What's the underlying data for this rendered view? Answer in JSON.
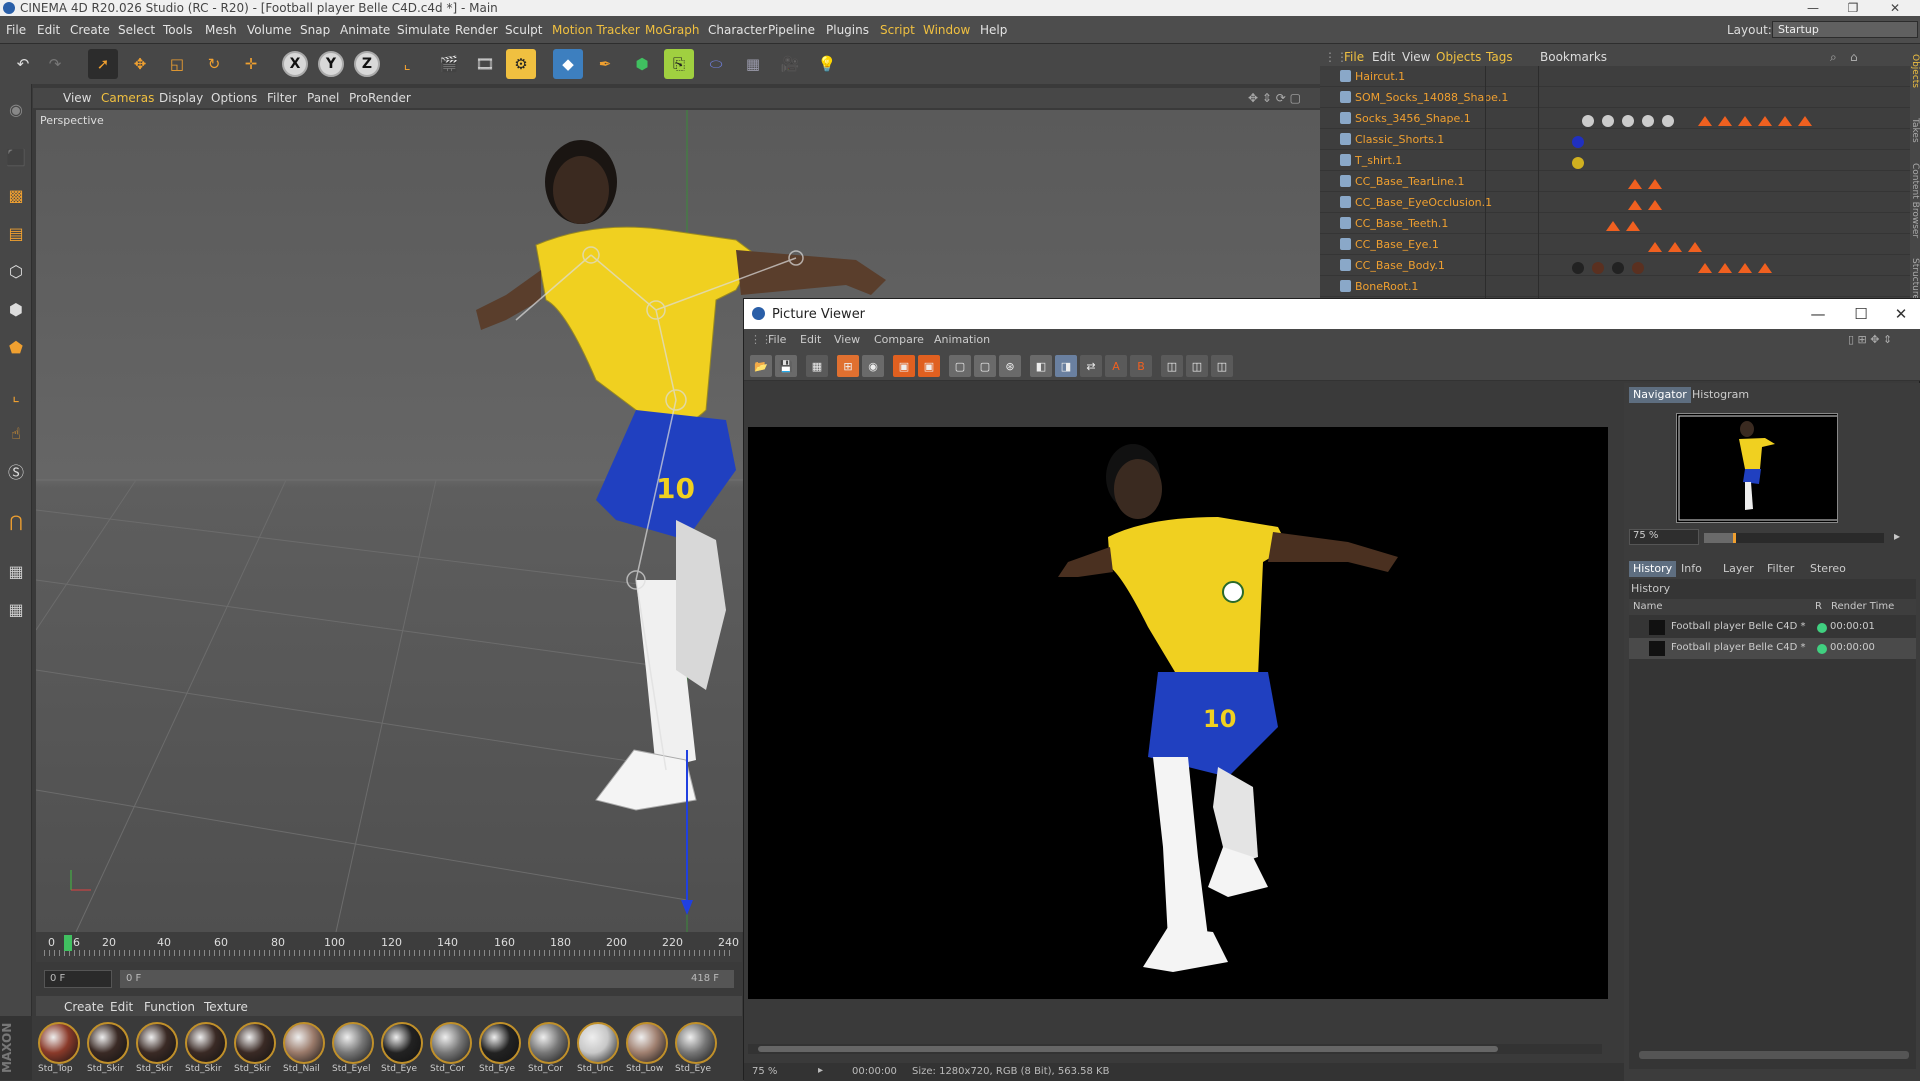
{
  "window": {
    "title": "CINEMA 4D R20.026 Studio (RC - R20) - [Football player Belle C4D.c4d *] - Main"
  },
  "menubar": {
    "items": [
      "File",
      "Edit",
      "Create",
      "Select",
      "Tools",
      "Mesh",
      "Volume",
      "Snap",
      "Animate",
      "Simulate",
      "Render",
      "Sculpt",
      "Motion Tracker",
      "MoGraph",
      "Character",
      "Pipeline",
      "Plugins",
      "Script",
      "Window",
      "Help"
    ],
    "layout_label": "Layout:",
    "layout_value": "Startup"
  },
  "viewport": {
    "menu": [
      "View",
      "Cameras",
      "Display",
      "Options",
      "Filter",
      "Panel",
      "ProRender"
    ],
    "label": "Perspective"
  },
  "timeline": {
    "ticks": [
      "0",
      "6",
      "20",
      "40",
      "60",
      "80",
      "100",
      "120",
      "140",
      "160",
      "180",
      "200",
      "220",
      "240"
    ],
    "frame_field": "0 F",
    "range_start": "0 F",
    "range_end": "418 F"
  },
  "materials": {
    "menu": [
      "Create",
      "Edit",
      "Function",
      "Texture"
    ],
    "items": [
      {
        "label": "Std_Top",
        "color": "#8a3a2a"
      },
      {
        "label": "Std_Skir",
        "color": "#3a2a25"
      },
      {
        "label": "Std_Skir",
        "color": "#3a2a25"
      },
      {
        "label": "Std_Skir",
        "color": "#3a2a25"
      },
      {
        "label": "Std_Skir",
        "color": "#3a2a25"
      },
      {
        "label": "Std_Nail",
        "color": "#9a7a6a"
      },
      {
        "label": "Std_Eyel",
        "color": "#777777"
      },
      {
        "label": "Std_Eye",
        "color": "#222222"
      },
      {
        "label": "Std_Cor",
        "color": "#777777"
      },
      {
        "label": "Std_Eye",
        "color": "#222222"
      },
      {
        "label": "Std_Cor",
        "color": "#777777"
      },
      {
        "label": "Std_Unc",
        "color": "#c8c8c8"
      },
      {
        "label": "Std_Low",
        "color": "#a08070"
      },
      {
        "label": "Std_Eye",
        "color": "#777777"
      }
    ]
  },
  "objects": {
    "menu": [
      "File",
      "Edit",
      "View",
      "Objects",
      "Tags",
      "Bookmarks"
    ],
    "rows": [
      {
        "name": "Haircut.1"
      },
      {
        "name": "SOM_Socks_14088_Shape.1"
      },
      {
        "name": "Socks_3456_Shape.1"
      },
      {
        "name": "Classic_Shorts.1"
      },
      {
        "name": "T_shirt.1"
      },
      {
        "name": "CC_Base_TearLine.1"
      },
      {
        "name": "CC_Base_EyeOcclusion.1"
      },
      {
        "name": "CC_Base_Teeth.1"
      },
      {
        "name": "CC_Base_Eye.1"
      },
      {
        "name": "CC_Base_Body.1"
      },
      {
        "name": "BoneRoot.1"
      }
    ]
  },
  "picture_viewer": {
    "title": "Picture Viewer",
    "menu": [
      "File",
      "Edit",
      "View",
      "Compare",
      "Animation"
    ],
    "side_tabs": [
      "Navigator",
      "Histogram"
    ],
    "zoom": "75 %",
    "zoom_fraction": 0.16,
    "lower_tabs": [
      "History",
      "Info",
      "Layer",
      "Filter",
      "Stereo"
    ],
    "history_title": "History",
    "columns": {
      "name": "Name",
      "r": "R",
      "render_time": "Render Time"
    },
    "history_rows": [
      {
        "name": "Football player Belle C4D *",
        "time": "00:00:01"
      },
      {
        "name": "Football player Belle C4D *",
        "time": "00:00:00"
      }
    ],
    "status": {
      "zoom": "75 %",
      "time": "00:00:00",
      "info": "Size: 1280x720, RGB (8 Bit), 563.58 KB"
    }
  },
  "right_strip": [
    "Objects",
    "Takes",
    "Content Browser",
    "Structure"
  ],
  "colors": {
    "accent": "#f0a030",
    "highlight": "#f0c040",
    "jersey": "#f0d020",
    "shorts": "#2040c0"
  }
}
